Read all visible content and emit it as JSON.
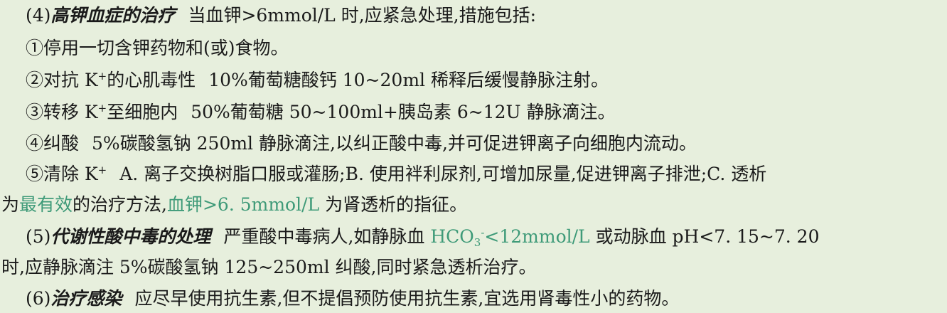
{
  "p4": {
    "number": "(4)",
    "heading": "高钾血症的治疗",
    "text": "当血钾>6mmol/L 时,应紧急处理,措施包括:"
  },
  "items": [
    {
      "mark": "①",
      "text": "停用一切含钾药物和(或)食物。"
    },
    {
      "mark": "②",
      "label_pre": "对抗 K",
      "sup": "+",
      "label_post": "的心肌毒性",
      "text": "10%葡萄糖酸钙 10~20ml 稀释后缓慢静脉注射。"
    },
    {
      "mark": "③",
      "label_pre": "转移 K",
      "sup": "+",
      "label_post": "至细胞内",
      "text": "50%葡萄糖 50~100ml+胰岛素 6~12U 静脉滴注。"
    },
    {
      "mark": "④",
      "label_pre": "纠酸",
      "text": "5%碳酸氢钠 250ml 静脉滴注,以纠正酸中毒,并可促进钾离子向细胞内流动。"
    },
    {
      "mark": "⑤",
      "label_pre": "清除 K",
      "sup": "+",
      "text": "A. 离子交换树脂口服或灌肠;B. 使用袢利尿剂,可增加尿量,促进钾离子排泄;C. 透析"
    }
  ],
  "item5_cont": {
    "pre": "为",
    "green1": "最有效",
    "mid": "的治疗方法,",
    "green2": "血钾>6. 5mmol/L",
    "post": " 为肾透析的指征。"
  },
  "p5": {
    "number": "(5)",
    "heading": "代谢性酸中毒的处理",
    "text_pre": "严重酸中毒病人,如静脉血 ",
    "green_pre": "HCO",
    "green_sub": "3",
    "green_sup": "-",
    "green_post": "<12mmol/L",
    "text_post": " 或动脉血 pH<7. 15~7. 20",
    "cont": "时,应静脉滴注 5%碳酸氢钠 125~250ml 纠酸,同时紧急透析治疗。"
  },
  "p6": {
    "number": "(6)",
    "heading": "治疗感染",
    "text": "应尽早使用抗生素,但不提倡预防使用抗生素,宜选用肾毒性小的药物。"
  },
  "colors": {
    "background": "#e7efdd",
    "text": "#1a1a1a",
    "highlight": "#3e9a78"
  }
}
